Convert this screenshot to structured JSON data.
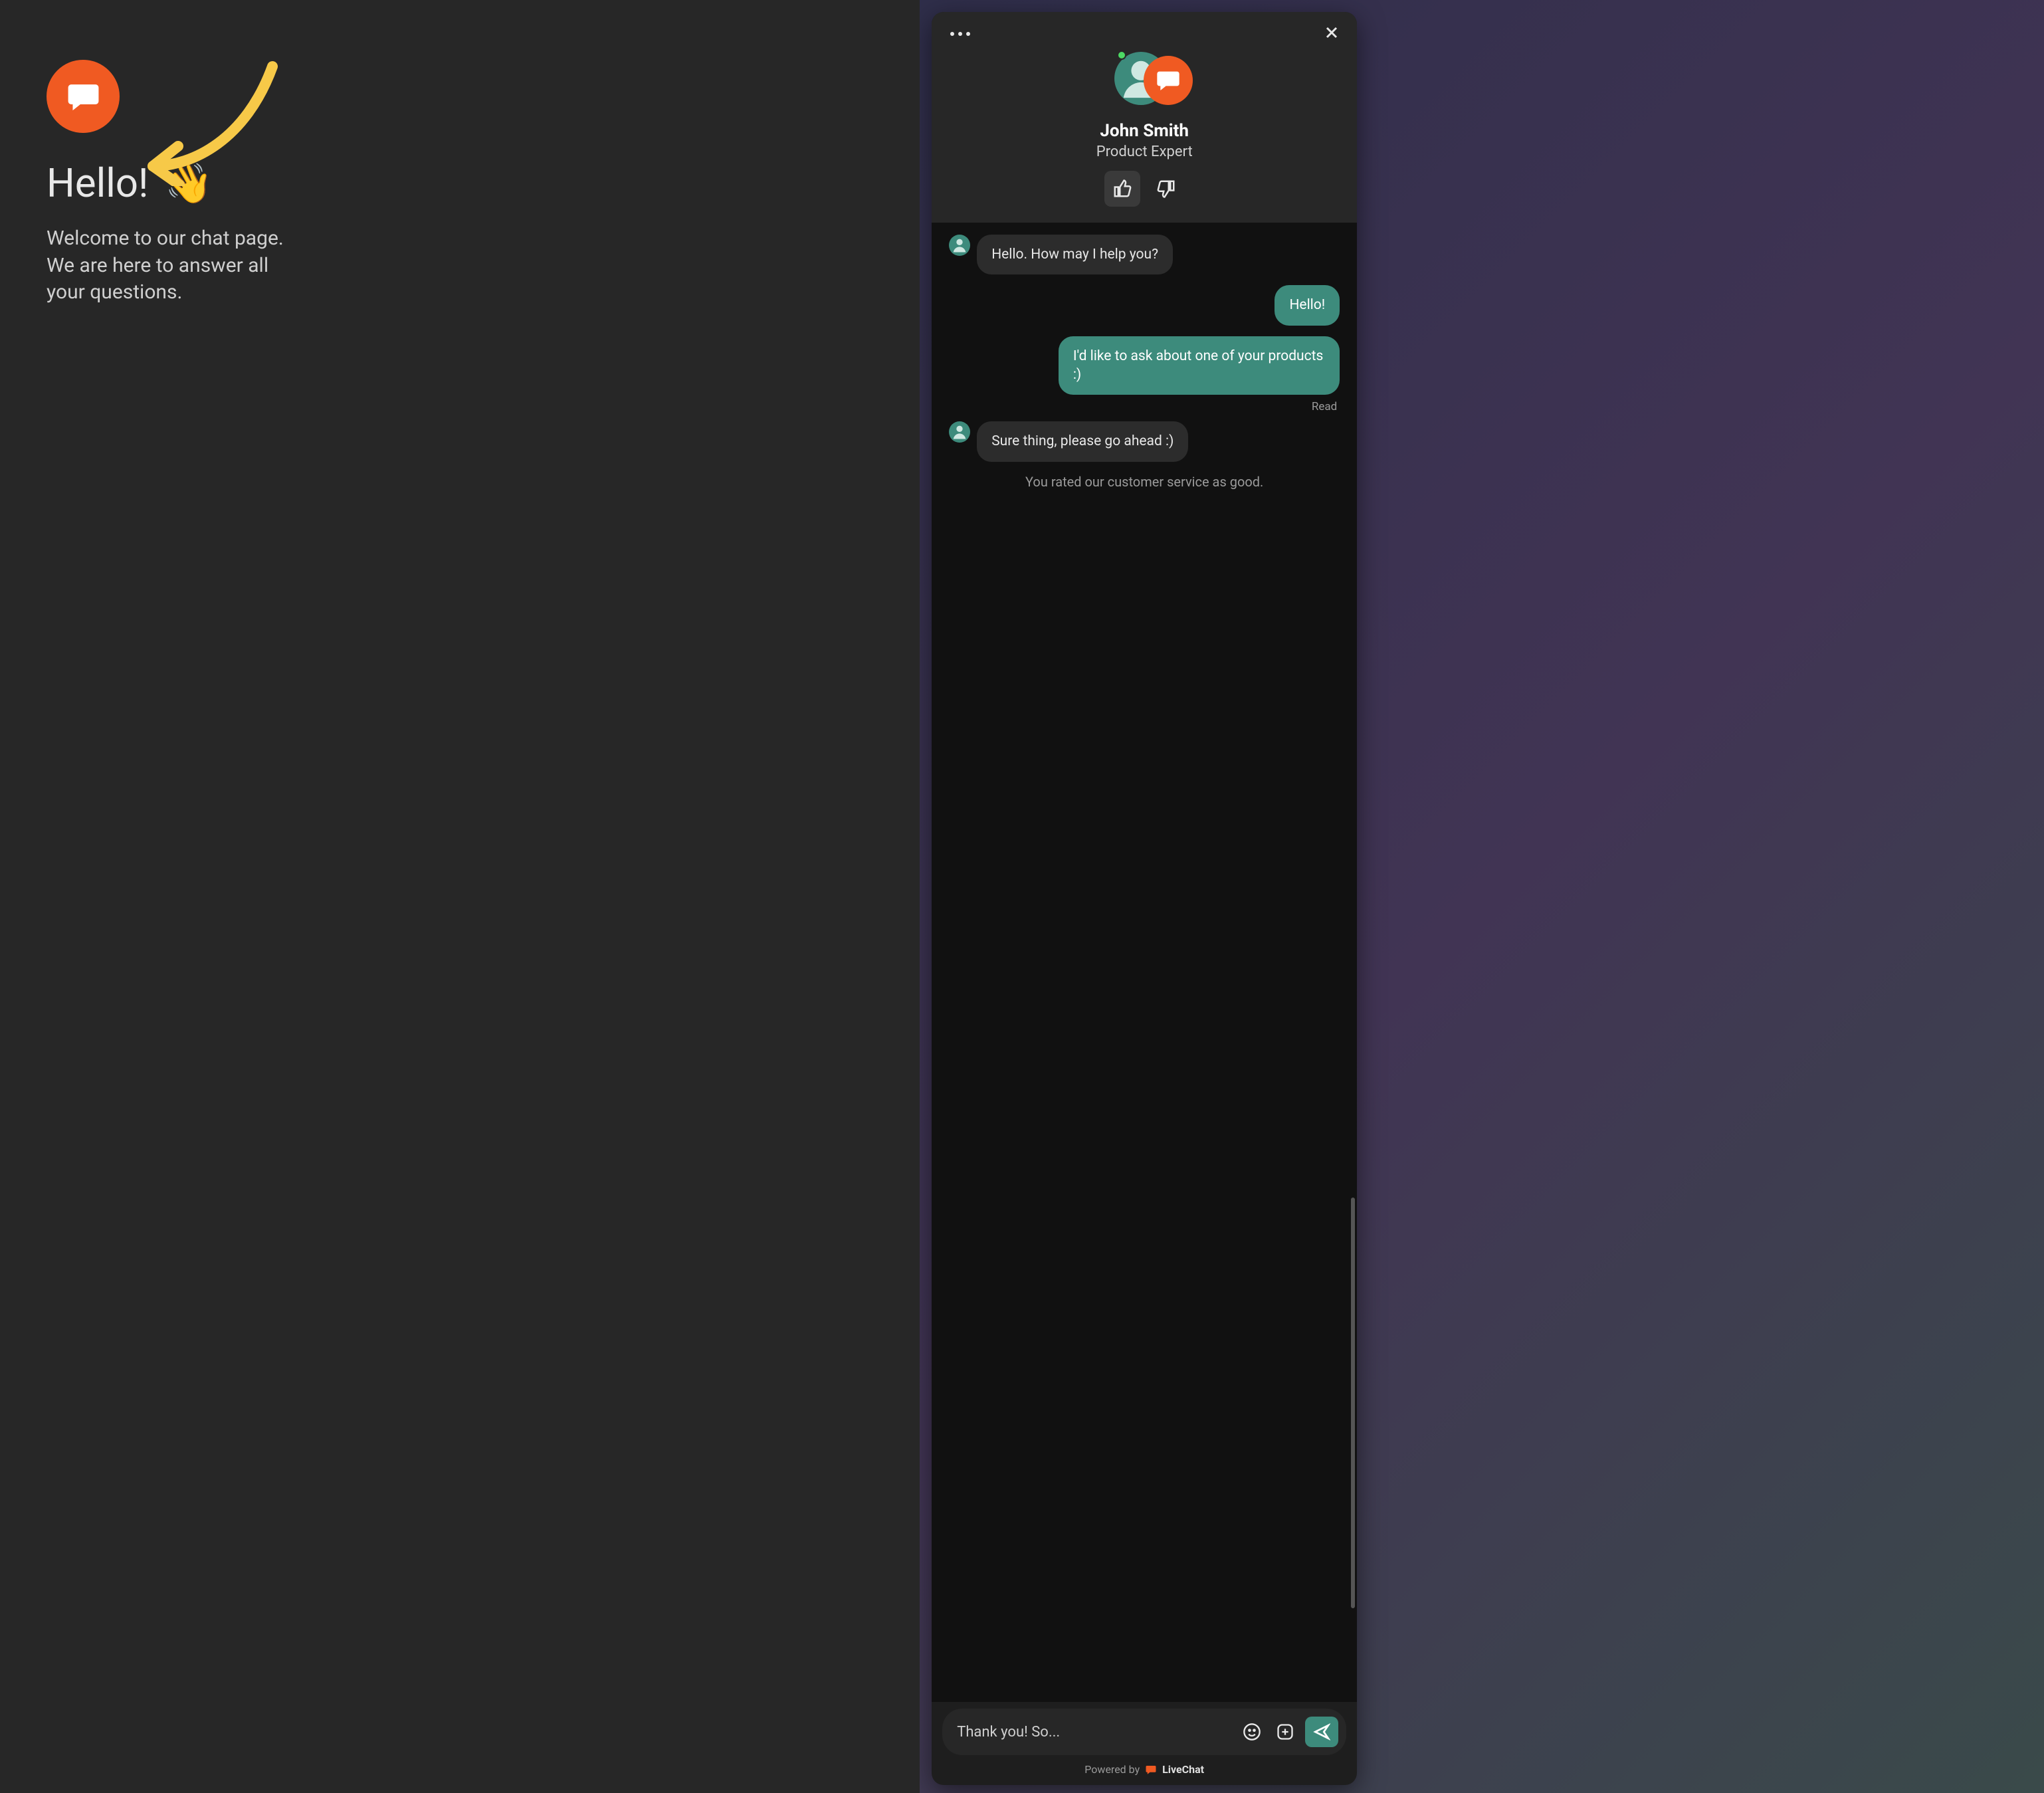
{
  "left": {
    "greeting": "Hello!",
    "wave_emoji": "👋",
    "welcome_text": "Welcome to our chat page. We are here to answer all your questions."
  },
  "widget": {
    "agent": {
      "name": "John Smith",
      "role": "Product Expert",
      "status": "online"
    },
    "rating": {
      "selected": "good"
    },
    "messages": [
      {
        "from": "agent",
        "text": "Hello. How may I help you?"
      },
      {
        "from": "user",
        "text": "Hello!"
      },
      {
        "from": "user",
        "text": "I'd like to ask about one of your products :)"
      },
      {
        "from": "agent",
        "text": "Sure thing, please go ahead :)"
      }
    ],
    "read_receipt": "Read",
    "rating_line": "You rated our customer service as good.",
    "input": {
      "value": "Thank you! So..."
    },
    "footer": {
      "prefix": "Powered by",
      "brand": "LiveChat"
    }
  },
  "colors": {
    "accent_orange": "#f05a22",
    "accent_teal": "#3d8b7c"
  }
}
